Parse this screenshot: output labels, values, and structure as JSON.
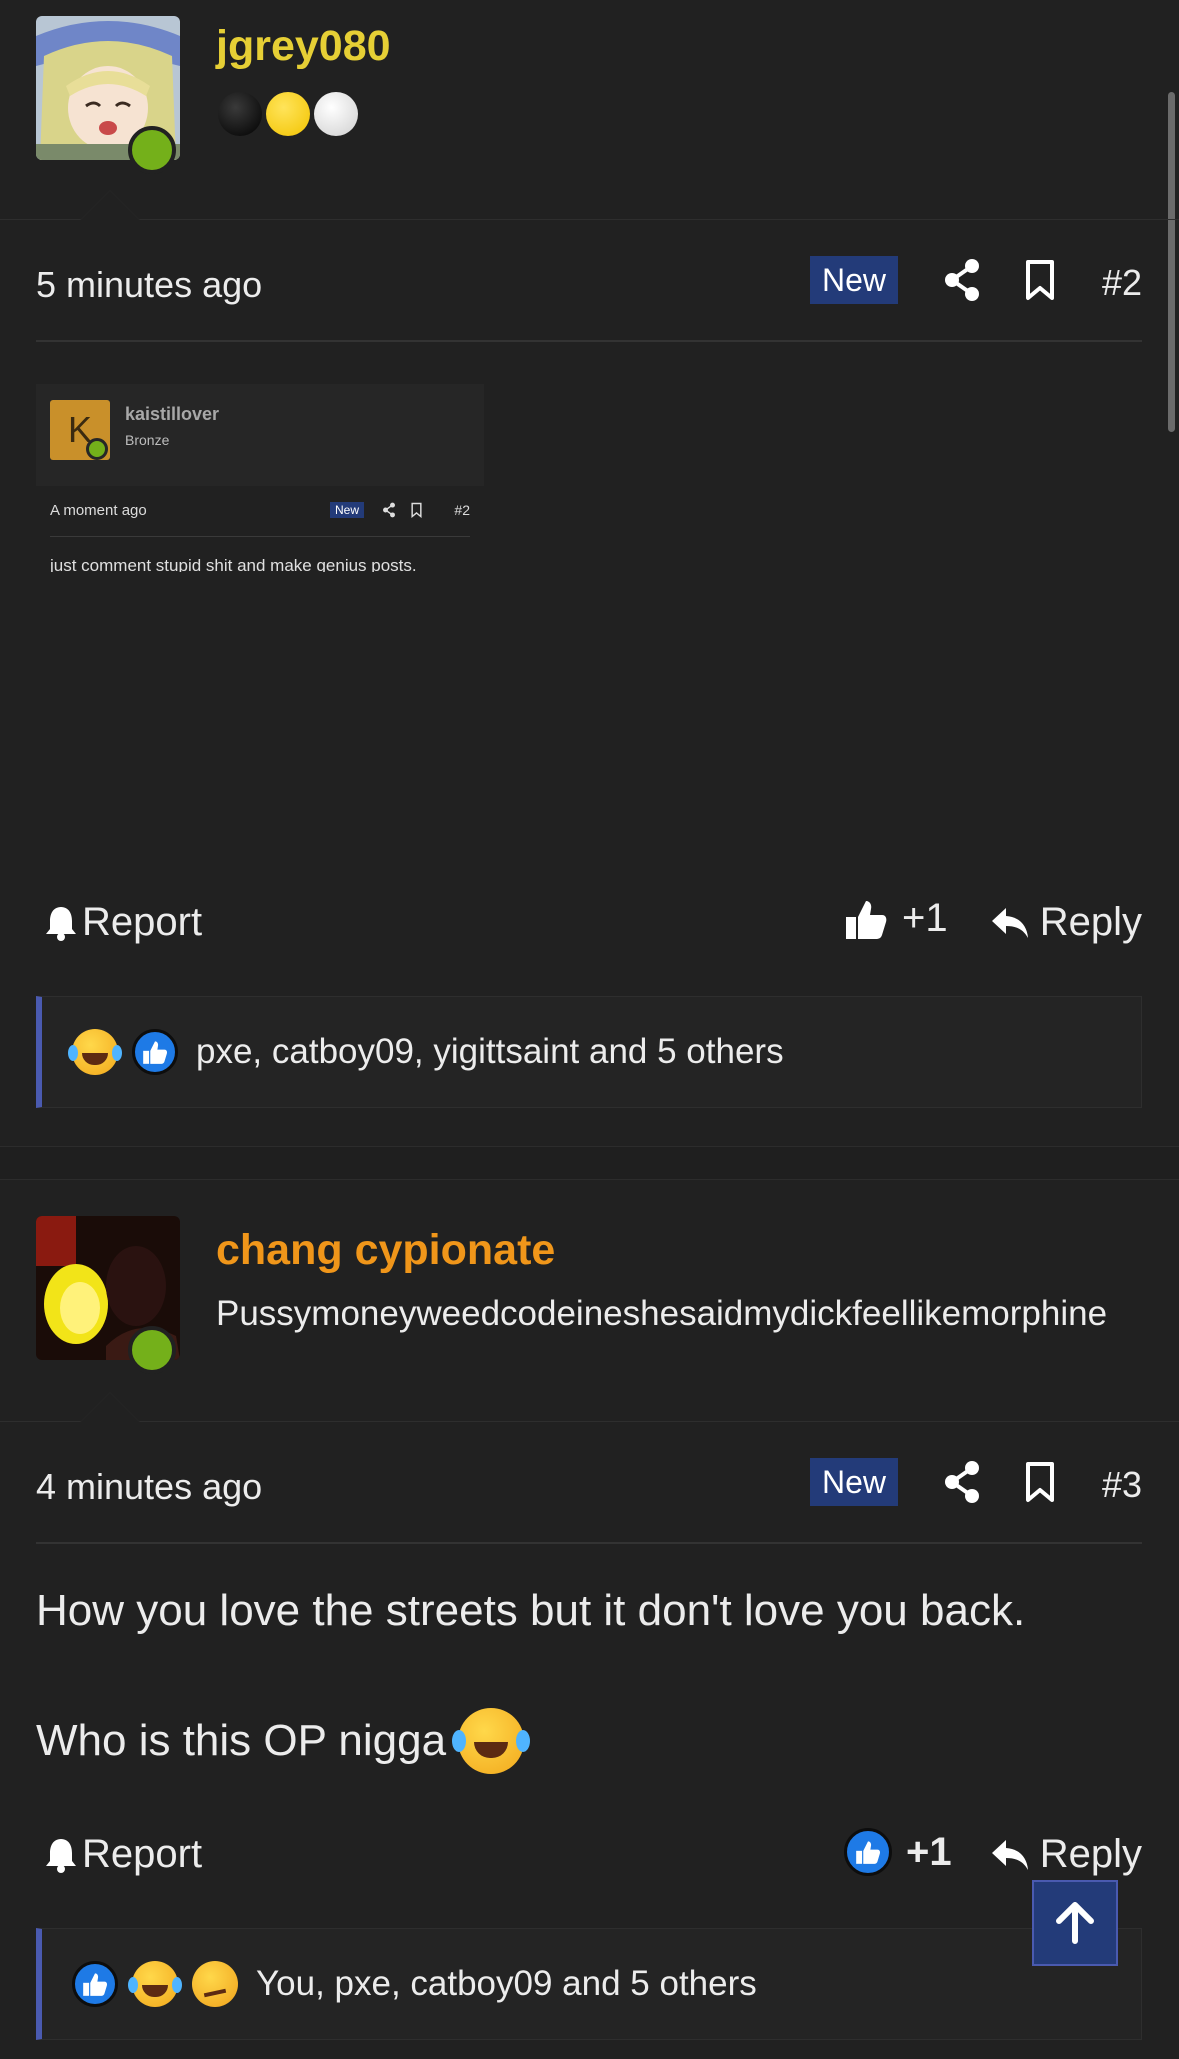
{
  "posts": [
    {
      "username": "jgrey080",
      "username_color": "#e6cf35",
      "rank_dots": [
        "#000000",
        "#f7d20c",
        "#e6e6e6"
      ],
      "timestamp": "5 minutes ago",
      "badge": "New",
      "post_number": "#2",
      "embed": {
        "avatar_letter": "K",
        "username": "kaistillover",
        "rank": "Bronze",
        "timestamp": "A moment ago",
        "badge": "New",
        "post_number": "#2",
        "text": "just comment stupid shit and make genius posts."
      },
      "actions": {
        "report": "Report",
        "like_count": "+1",
        "reply": "Reply"
      },
      "reactions": {
        "icons": [
          "laugh-cry-emoji",
          "thumbs-up-emoji"
        ],
        "text": "pxe, catboy09, yigittsaint and 5 others"
      }
    },
    {
      "username": "chang cypionate",
      "username_color": "#f0961a",
      "subtitle": "Pussymoneyweedcodeineshesaidmydickfeellikemorphine",
      "timestamp": "4 minutes ago",
      "badge": "New",
      "post_number": "#3",
      "body_line1": "How you love the streets but it don't love you back.",
      "body_line2": "Who is this OP nigga",
      "actions": {
        "report": "Report",
        "like_count": "+1",
        "reply": "Reply"
      },
      "reactions": {
        "icons": [
          "thumbs-up-emoji",
          "laugh-cry-emoji",
          "thinking-emoji"
        ],
        "text": "You, pxe, catboy09 and 5 others"
      }
    }
  ]
}
